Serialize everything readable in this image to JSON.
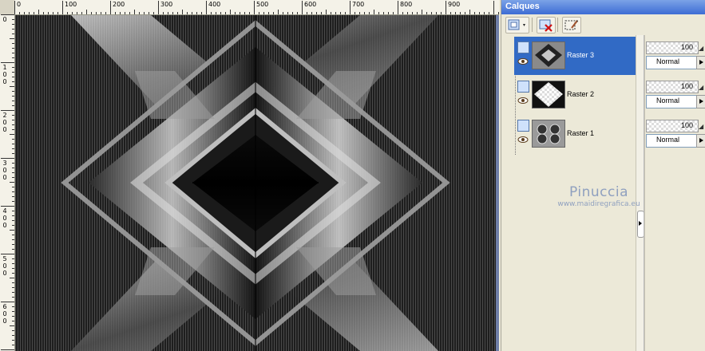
{
  "app": {
    "panel_title": "Calques"
  },
  "rulers": {
    "top_labels": [
      "0",
      "100",
      "200",
      "300",
      "400",
      "500",
      "600",
      "700",
      "800",
      "900"
    ],
    "left_labels": [
      "0",
      "1\n0\n0",
      "2\n0\n0",
      "3\n0\n0",
      "4\n0\n0",
      "5\n0\n0",
      "6\n0\n0"
    ]
  },
  "toolbar": {
    "icons": [
      "new-layer-icon",
      "delete-layer-icon",
      "mask-edit-icon"
    ]
  },
  "layers": [
    {
      "name": "Raster 3",
      "selected": true,
      "opacity": "100",
      "blend": "Normal"
    },
    {
      "name": "Raster 2",
      "selected": false,
      "opacity": "100",
      "blend": "Normal"
    },
    {
      "name": "Raster 1",
      "selected": false,
      "opacity": "100",
      "blend": "Normal"
    }
  ],
  "watermark": {
    "title": "Pinuccia",
    "url": "www.maidiregrafica.eu"
  },
  "colors": {
    "titlebar": "#3d6cd4",
    "selection": "#316ac5",
    "panel_bg": "#ece9d8"
  }
}
